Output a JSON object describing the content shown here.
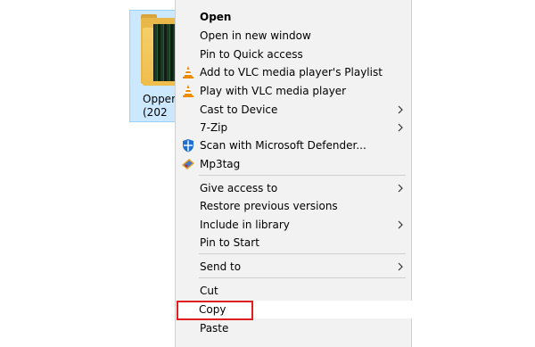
{
  "desktop": {
    "folder_name_line1": "Opper",
    "folder_name_line2": "(202"
  },
  "menu": {
    "items": [
      {
        "label": "Open",
        "icon": "",
        "submenu": false
      },
      {
        "label": "Open in new window",
        "icon": "",
        "submenu": false
      },
      {
        "label": "Pin to Quick access",
        "icon": "",
        "submenu": false
      },
      {
        "label": "Add to VLC media player's Playlist",
        "icon": "vlc-cone-icon",
        "submenu": false
      },
      {
        "label": "Play with VLC media player",
        "icon": "vlc-cone-icon",
        "submenu": false
      },
      {
        "label": "Cast to Device",
        "icon": "",
        "submenu": true
      },
      {
        "label": "7-Zip",
        "icon": "",
        "submenu": true
      },
      {
        "label": "Scan with Microsoft Defender...",
        "icon": "defender-shield-icon",
        "submenu": false
      },
      {
        "label": "Mp3tag",
        "icon": "mp3tag-icon",
        "submenu": false
      },
      {
        "label": "Give access to",
        "icon": "",
        "submenu": true
      },
      {
        "label": "Restore previous versions",
        "icon": "",
        "submenu": false
      },
      {
        "label": "Include in library",
        "icon": "",
        "submenu": true
      },
      {
        "label": "Pin to Start",
        "icon": "",
        "submenu": false
      },
      {
        "label": "Send to",
        "icon": "",
        "submenu": true
      },
      {
        "label": "Cut",
        "icon": "",
        "submenu": false
      },
      {
        "label": "Copy",
        "icon": "",
        "submenu": false
      },
      {
        "label": "Paste",
        "icon": "",
        "submenu": false
      }
    ]
  },
  "colors": {
    "menu_bg": "#f2f2f2",
    "highlight_border": "#e02020",
    "selection_bg": "#cce8ff"
  }
}
